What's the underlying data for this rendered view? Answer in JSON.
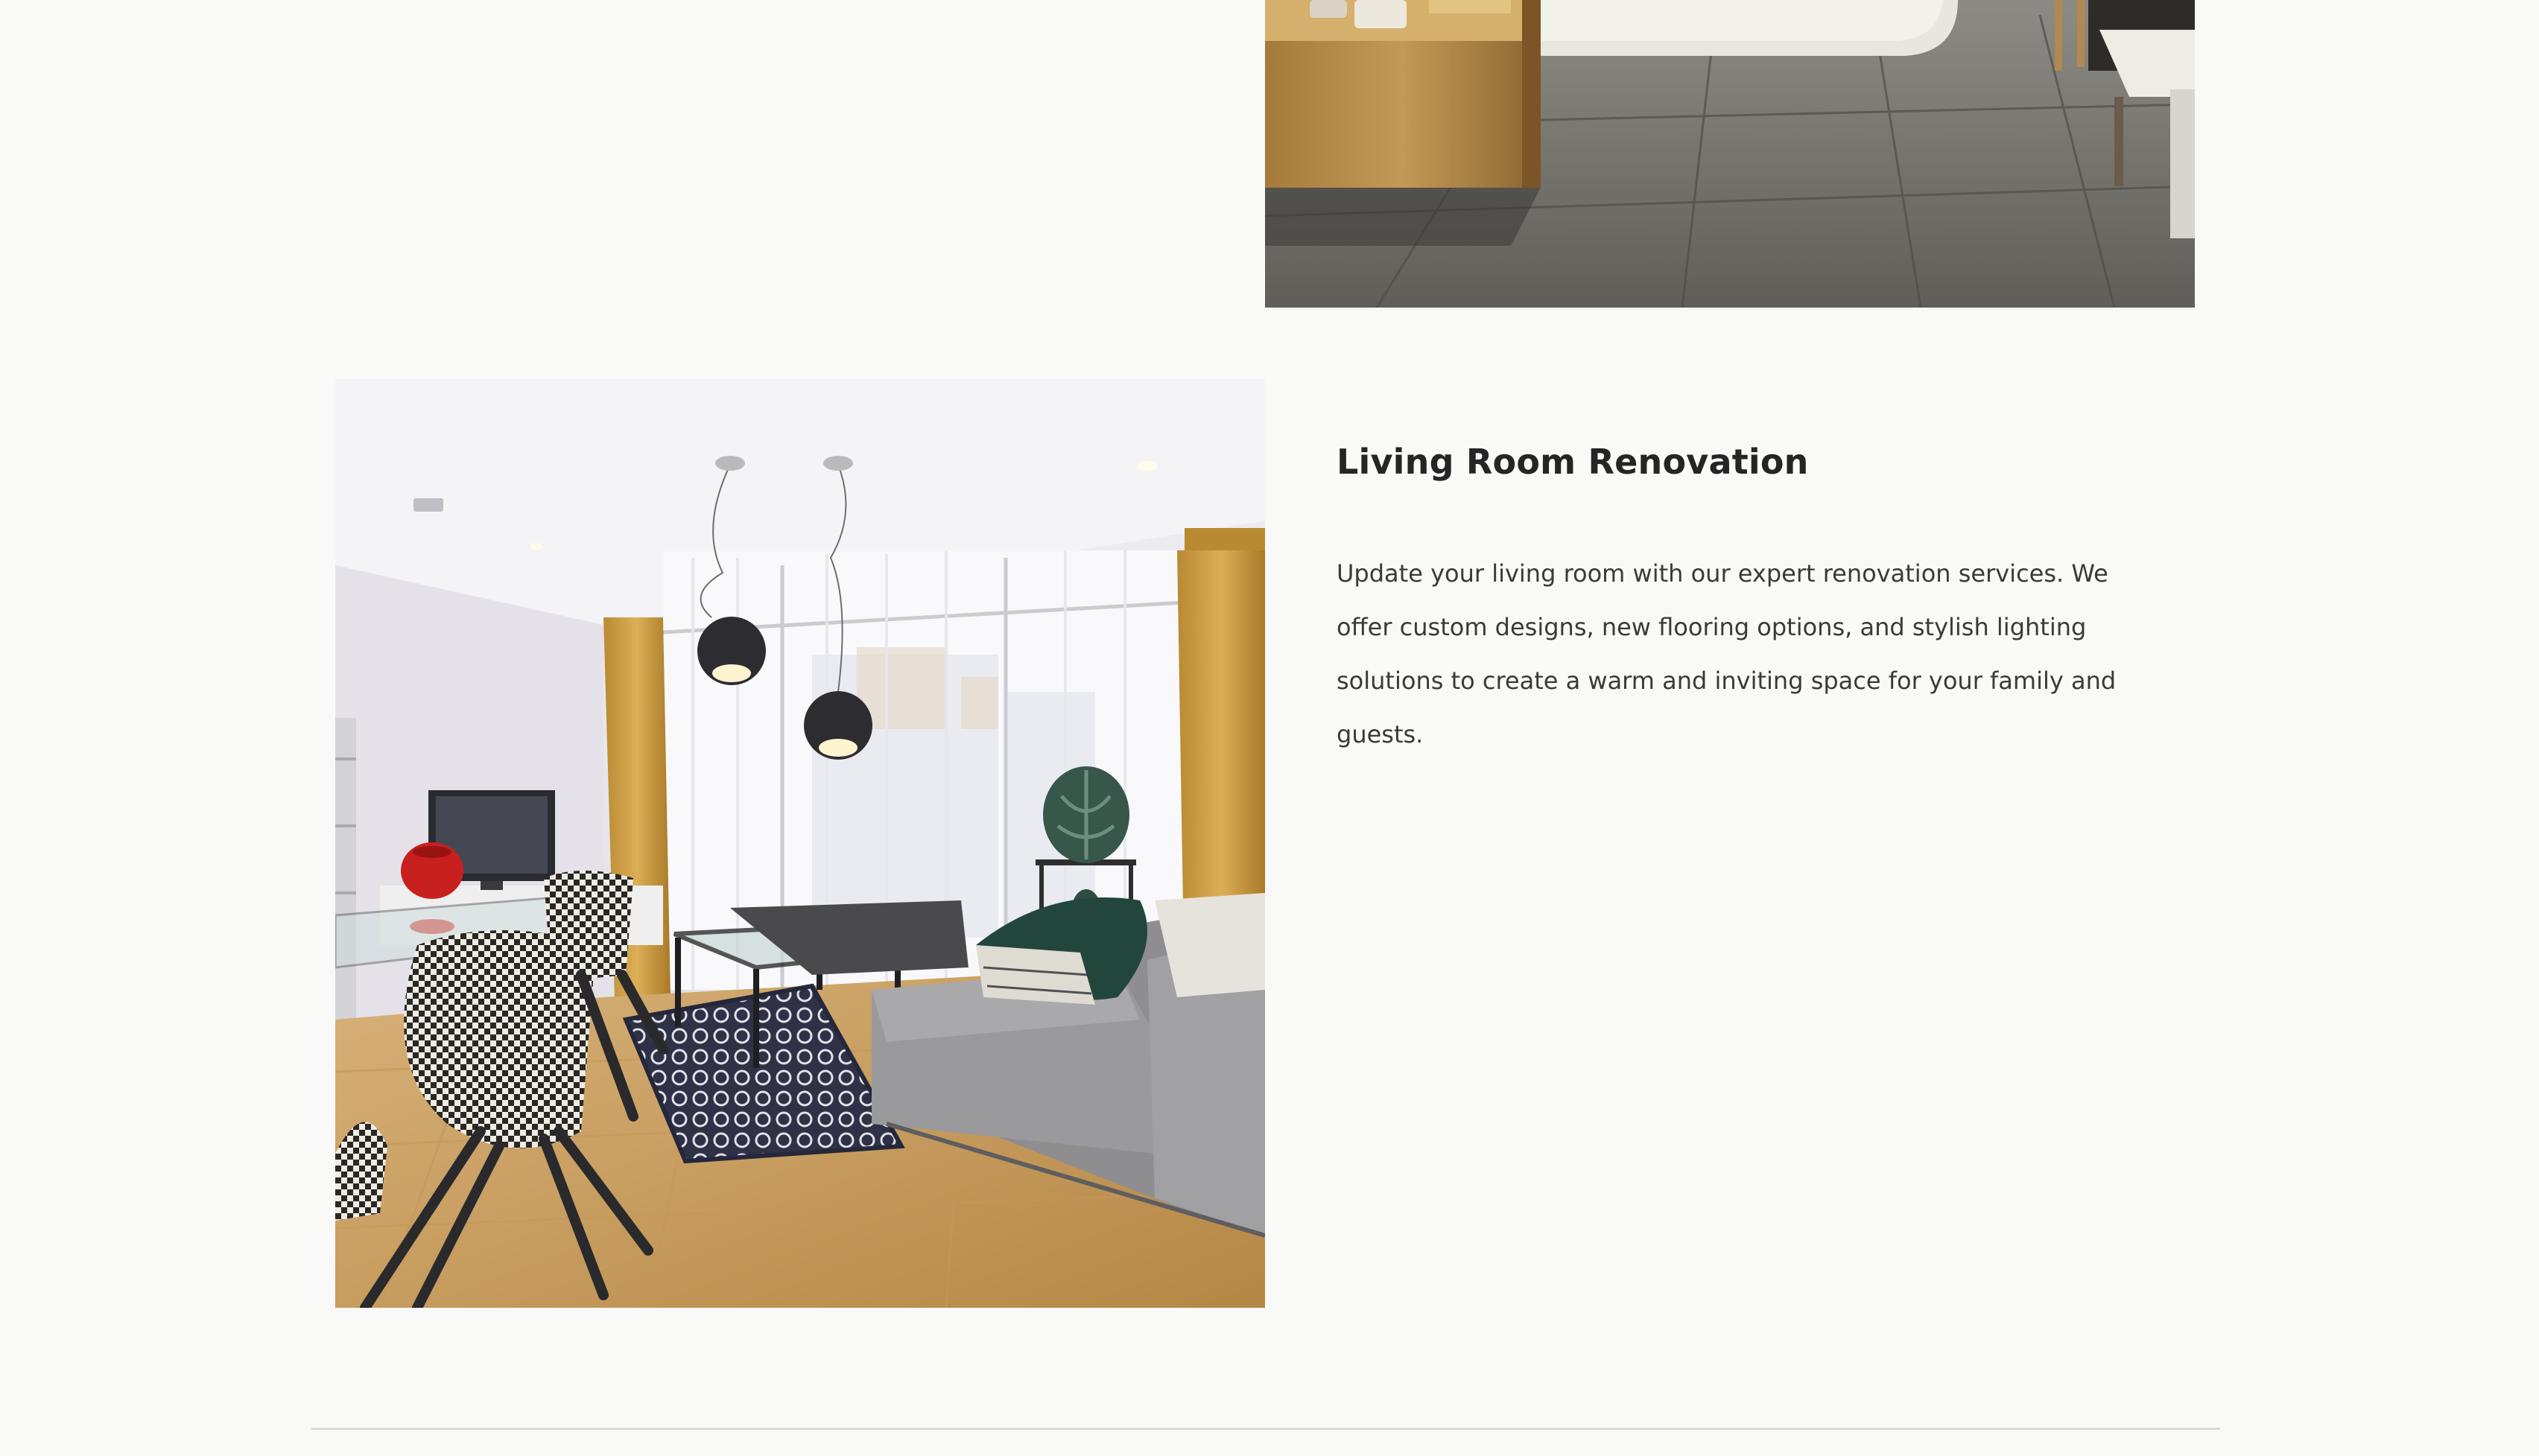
{
  "sections": [
    {
      "image": {
        "icon": "bathroom-photo",
        "subject": "bathroom"
      }
    },
    {
      "image": {
        "icon": "living-room-photo",
        "subject": "living room"
      },
      "title": "Living Room Renovation",
      "description": "Update your living room with our expert renovation services. We offer custom designs, new flooring options, and stylish lighting solutions to create a warm and inviting space for your family and guests."
    }
  ],
  "colors": {
    "background": "#f9f9f7",
    "title": "#252525",
    "body_text": "#3a3a3a",
    "divider": "#dadad6"
  }
}
